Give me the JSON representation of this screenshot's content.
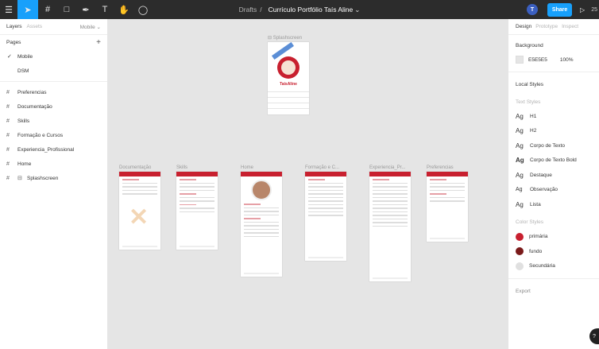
{
  "toolbar": {
    "breadcrumb_parent": "Drafts",
    "breadcrumb_sep": "/",
    "file_name": "Currículo Portfólio Taís Aline",
    "avatar_initial": "T",
    "share_label": "Share",
    "zoom": "25",
    "icons": [
      "menu-icon",
      "move-icon",
      "frame-icon",
      "shape-icon",
      "pen-icon",
      "text-icon",
      "hand-icon",
      "comment-icon"
    ]
  },
  "left_panel": {
    "tabs": [
      "Layers",
      "Assets"
    ],
    "page_selector": "Mobile",
    "pages_title": "Pages",
    "pages": [
      {
        "label": "Mobile",
        "selected": true
      },
      {
        "label": "DSM",
        "selected": false
      }
    ],
    "layers": [
      {
        "label": "Preferencias",
        "icon": "frame-icon"
      },
      {
        "label": "Documentação",
        "icon": "frame-icon"
      },
      {
        "label": "Skills",
        "icon": "frame-icon"
      },
      {
        "label": "Formação e Cursos",
        "icon": "frame-icon"
      },
      {
        "label": "Experiencia_Profissional",
        "icon": "frame-icon"
      },
      {
        "label": "Home",
        "icon": "frame-icon"
      },
      {
        "label": "Splashscreen",
        "icon": "frame-icon"
      }
    ]
  },
  "right_panel": {
    "tabs": [
      "Design",
      "Prototype",
      "Inspect"
    ],
    "background_title": "Background",
    "background_hex": "E5E5E5",
    "background_opacity": "100%",
    "local_styles_title": "Local Styles",
    "text_styles_title": "Text Styles",
    "text_styles": [
      {
        "sample": "Ag",
        "label": "H1"
      },
      {
        "sample": "Ag",
        "label": "H2"
      },
      {
        "sample": "Ag",
        "label": "Corpo de Texto"
      },
      {
        "sample": "Ag",
        "label": "Corpo de Texto Bold"
      },
      {
        "sample": "Ag",
        "label": "Destaque"
      },
      {
        "sample": "Ag",
        "label": "Observação"
      },
      {
        "sample": "Ag",
        "label": "Lista"
      }
    ],
    "color_styles_title": "Color Styles",
    "color_styles": [
      {
        "label": "primária",
        "color": "#c8202f"
      },
      {
        "label": "fundo",
        "color": "#7a1a1a"
      },
      {
        "label": "Secundária",
        "color": "#e0e0e0"
      }
    ],
    "export_title": "Export"
  },
  "canvas": {
    "splash_label": "Splashscreen",
    "splash_brand": "TaísAline",
    "frames": [
      {
        "label": "Documentação"
      },
      {
        "label": "Skills"
      },
      {
        "label": "Home"
      },
      {
        "label": "Formação e C..."
      },
      {
        "label": "Experiencia_Pr..."
      },
      {
        "label": "Preferencias"
      }
    ]
  },
  "help_label": "?"
}
